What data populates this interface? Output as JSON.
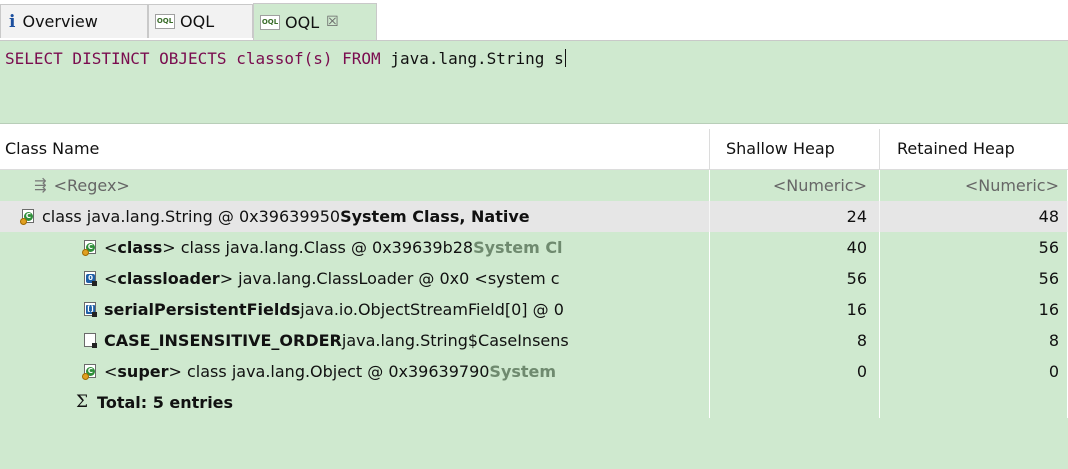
{
  "tabs": [
    {
      "label": "Overview",
      "icon": "info-icon"
    },
    {
      "label": "OQL",
      "icon": "oql-icon"
    },
    {
      "label": "OQL",
      "icon": "oql-icon",
      "active": true,
      "close": "☒"
    }
  ],
  "oql_icon_text": "OQL",
  "editor": {
    "query_kw1": "SELECT DISTINCT OBJECTS classof(s) FROM ",
    "query_plain": "java.lang.String s"
  },
  "table": {
    "columns": [
      "Class Name",
      "Shallow Heap",
      "Retained Heap"
    ],
    "filter": {
      "name": "<Regex>",
      "shallow": "<Numeric>",
      "retained": "<Numeric>"
    },
    "rows": [
      {
        "pre": "",
        "bold": "",
        "text": "class java.lang.String @ 0x39639950 ",
        "tail": "System Class, Native",
        "shallow": "24",
        "retained": "48"
      },
      {
        "pre": "<",
        "bold": "class",
        "text": "> class java.lang.Class @ 0x39639b28 ",
        "tail": "System Cl",
        "shallow": "40",
        "retained": "56"
      },
      {
        "pre": "<",
        "bold": "classloader",
        "text": "> java.lang.ClassLoader @ 0x0  <system c",
        "tail": "",
        "shallow": "56",
        "retained": "56"
      },
      {
        "pre": "",
        "bold": "serialPersistentFields",
        "text": " java.io.ObjectStreamField[0] @ 0",
        "tail": "",
        "shallow": "16",
        "retained": "16"
      },
      {
        "pre": "",
        "bold": "CASE_INSENSITIVE_ORDER",
        "text": " java.lang.String$CaseInsens",
        "tail": "",
        "shallow": "8",
        "retained": "8"
      },
      {
        "pre": "<",
        "bold": "super",
        "text": "> class java.lang.Object @ 0x39639790 ",
        "tail": "System",
        "shallow": "0",
        "retained": "0"
      }
    ],
    "total": "Total: 5 entries"
  },
  "colors": {
    "background": "#cfe9cf",
    "keyword": "#7a0d4f",
    "selected_row": "#e6e6e6"
  }
}
